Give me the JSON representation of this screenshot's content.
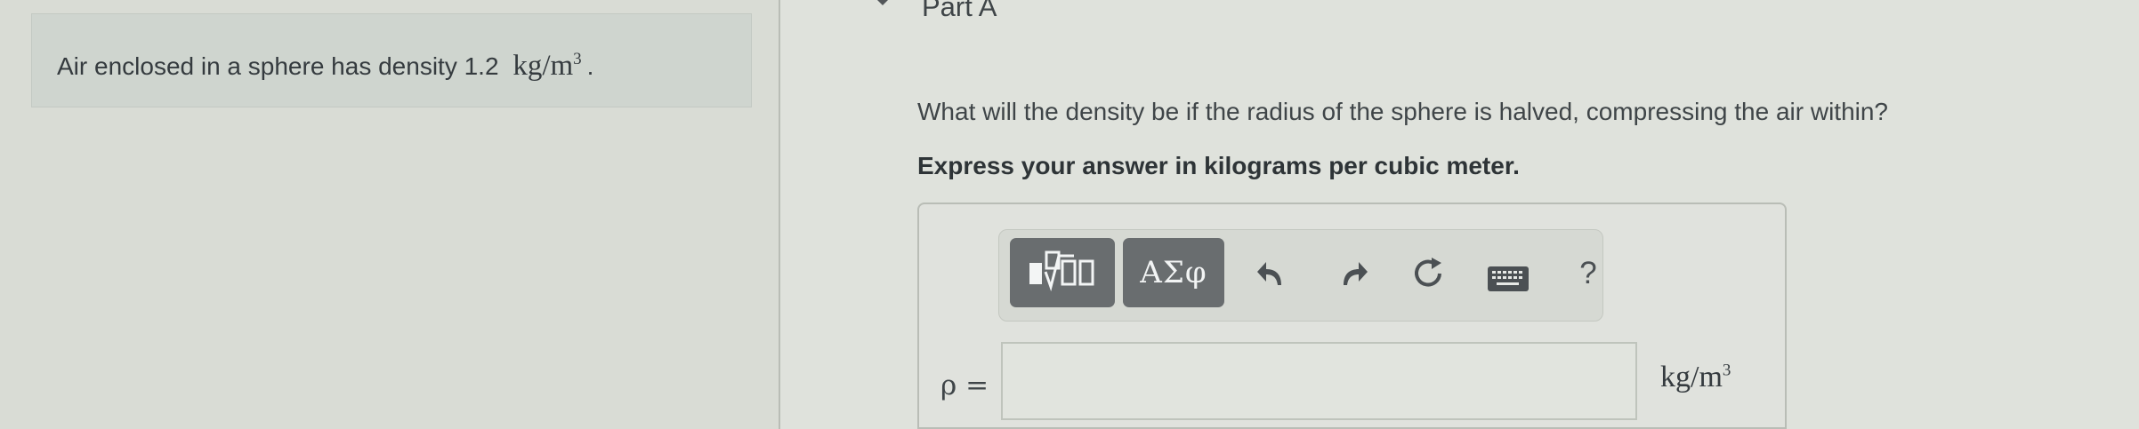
{
  "problem": {
    "text": "Air enclosed in a sphere has density 1.2",
    "unit_main": "kg/m",
    "unit_exp": "3",
    "trailing_dot": "."
  },
  "part": {
    "title": "Part A"
  },
  "question": {
    "text": "What will the density be if the radius of the sphere is halved, compressing the air within?",
    "instruction": "Express your answer in kilograms per cubic meter."
  },
  "toolbar": {
    "greek_label": "ΑΣφ",
    "help_label": "?"
  },
  "answer": {
    "variable_label": "ρ =",
    "input_value": "",
    "unit_main": "kg/m",
    "unit_exp": "3"
  },
  "icons": {
    "templates": "templates-icon",
    "undo": "undo-icon",
    "redo": "redo-icon",
    "reset": "reset-icon",
    "keyboard": "keyboard-icon",
    "help": "help-icon"
  },
  "colors": {
    "toolbar_button": "#696d6f",
    "text": "#3f4548"
  }
}
